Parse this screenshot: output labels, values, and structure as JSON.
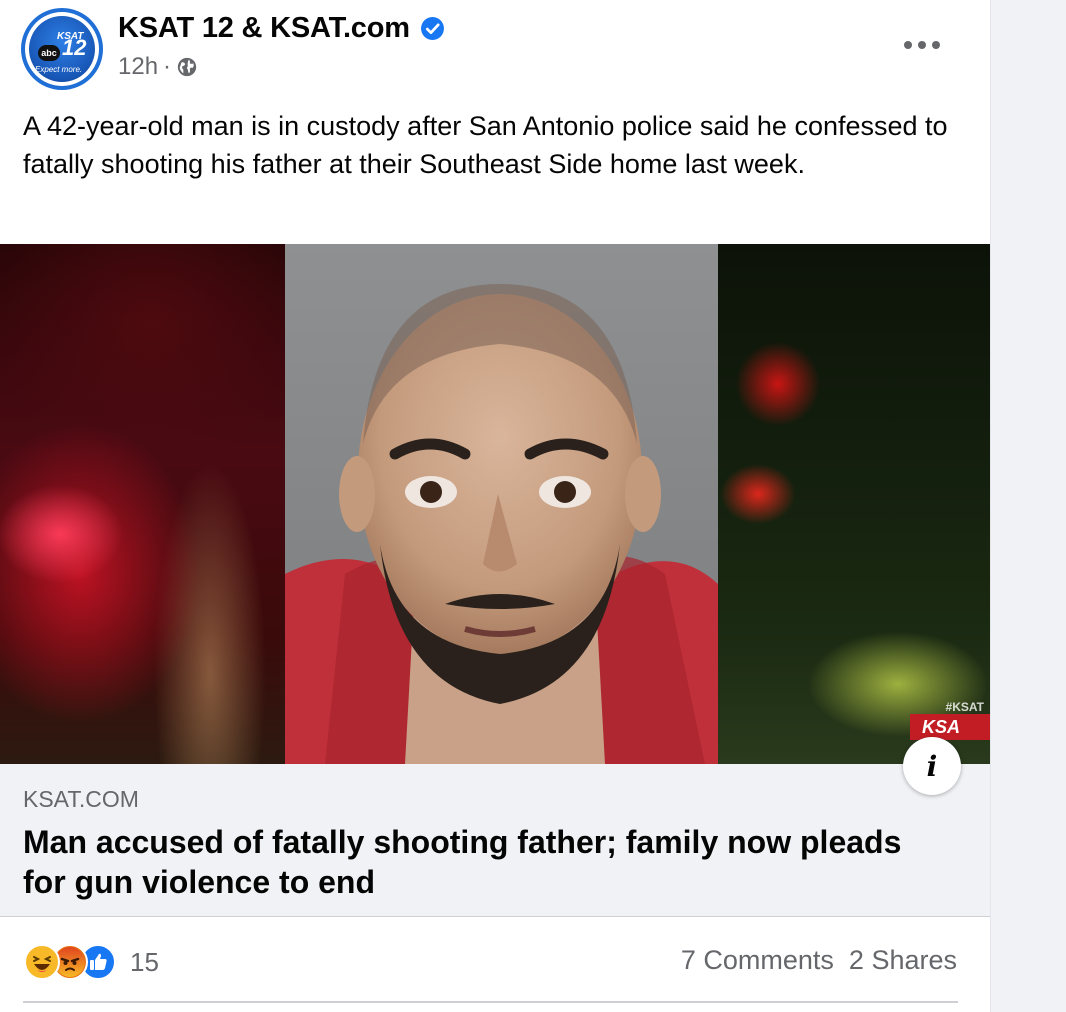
{
  "post": {
    "page_name": "KSAT 12 & KSAT.com",
    "avatar_logo": {
      "ksat": "KSAT",
      "number": "12",
      "abc": "abc",
      "tagline": "Expect more."
    },
    "verified_icon": "verified-badge-icon",
    "time": "12h",
    "separator": "·",
    "audience_icon": "globe-icon",
    "text": "A 42-year-old man is in custody after San Antonio police said he confessed to fatally shooting his father at their Southeast Side home last week."
  },
  "media": {
    "watermark_small": "#KSAT",
    "watermark_big": "KSA",
    "info_label": "i"
  },
  "link": {
    "domain": "KSAT.COM",
    "title": "Man accused of fatally shooting father; family now pleads for gun violence to end"
  },
  "footer": {
    "reactions": [
      "haha",
      "angry",
      "like"
    ],
    "reaction_count": "15",
    "comments": "7 Comments",
    "shares": "2 Shares"
  },
  "colors": {
    "brand_blue": "#1877f2",
    "secondary_text": "#65676b",
    "link_box_bg": "#f0f2f5"
  }
}
